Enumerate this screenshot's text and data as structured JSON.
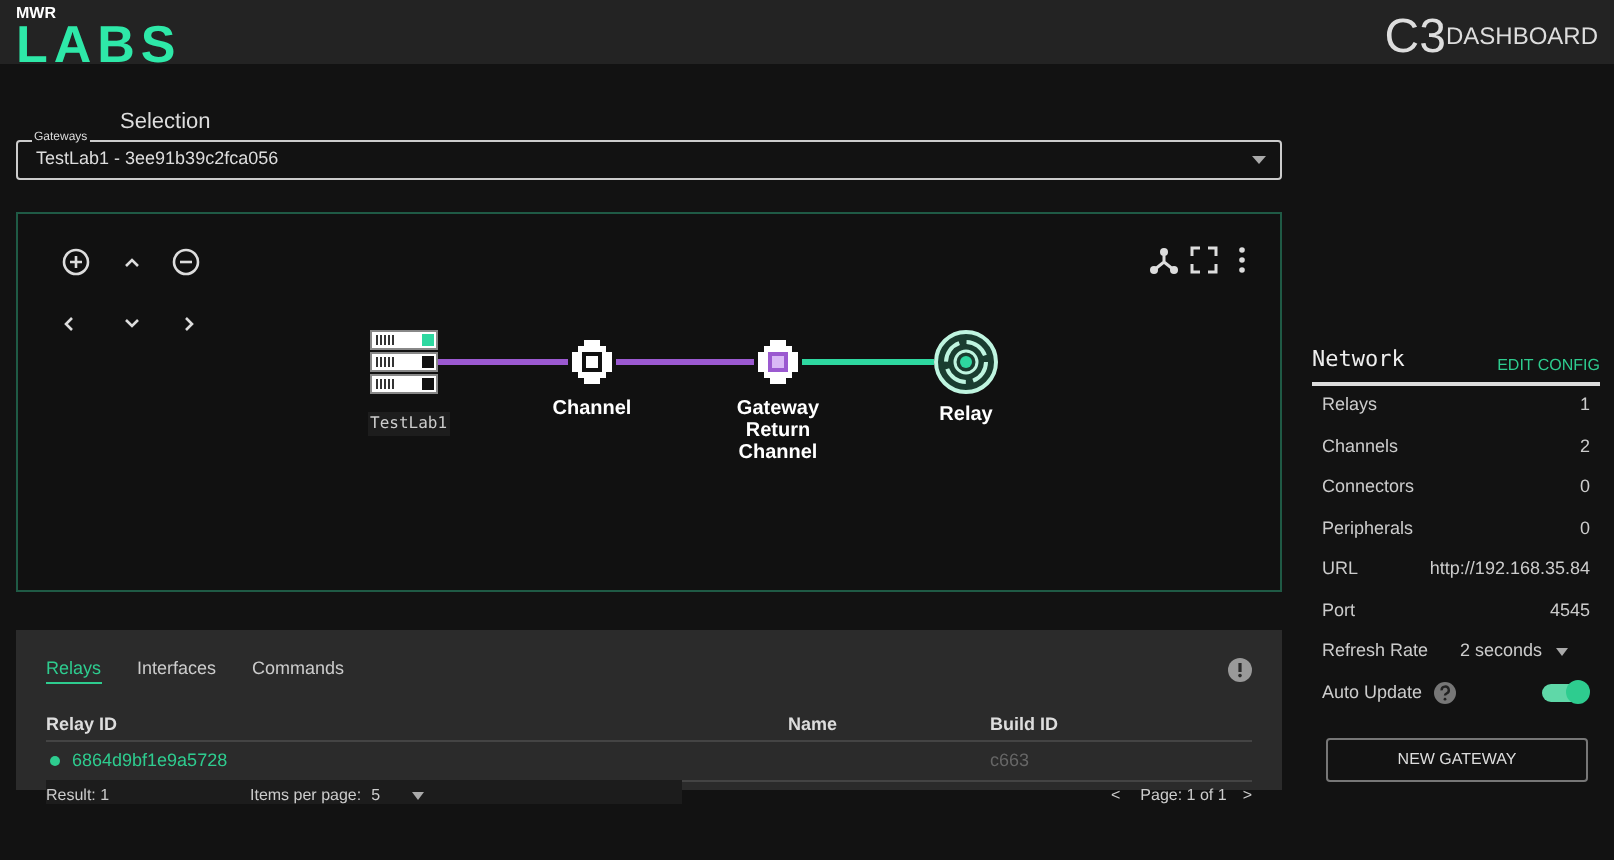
{
  "header": {
    "logo_small": "MWR",
    "logo": "LABS",
    "brand": "C3",
    "brand_sub": "DASHBOARD"
  },
  "gateway_select": {
    "heading": "Selection",
    "label": "Gateways",
    "value": "TestLab1 - 3ee91b39c2fca056"
  },
  "graph": {
    "nodes": [
      {
        "kind": "gateway",
        "label": "TestLab1"
      },
      {
        "kind": "channel",
        "label": "Channel"
      },
      {
        "kind": "return_channel",
        "label": "Gateway Return Channel"
      },
      {
        "kind": "relay",
        "label": "Relay"
      }
    ],
    "edges": [
      {
        "color": "#9b59d0"
      },
      {
        "color": "#9b59d0"
      },
      {
        "color": "#2ed8a0"
      }
    ]
  },
  "network": {
    "title": "Network",
    "action": "EDIT CONFIG",
    "rows": [
      {
        "label": "Relays",
        "value": "1"
      },
      {
        "label": "Channels",
        "value": "2"
      },
      {
        "label": "Connectors",
        "value": "0"
      },
      {
        "label": "Peripherals",
        "value": "0"
      },
      {
        "label": "URL",
        "value": "http://192.168.35.84"
      },
      {
        "label": "Port",
        "value": "4545"
      }
    ],
    "refresh": {
      "label": "Refresh Rate",
      "value": "2 seconds"
    },
    "auto_update": {
      "label": "Auto Update",
      "on": true
    },
    "button": "NEW GATEWAY"
  },
  "table": {
    "tabs": [
      {
        "label": "Relays",
        "selected": true
      },
      {
        "label": "Interfaces",
        "selected": false
      },
      {
        "label": "Commands",
        "selected": false
      }
    ],
    "columns": [
      "Relay ID",
      "Name",
      "Build ID"
    ],
    "rows": [
      {
        "relay_id": "6864d9bf1e9a5728",
        "build_id": "c663",
        "color": "#2ecc8f"
      }
    ],
    "footer": {
      "result": "Result: 1",
      "items_label": "Items per page:",
      "items_value": "5",
      "prev": "<",
      "page": "Page: 1 of 1",
      "next": ">"
    }
  }
}
